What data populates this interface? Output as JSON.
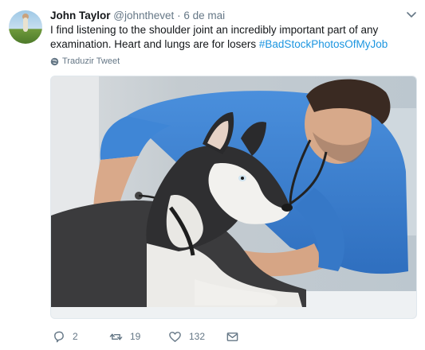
{
  "tweet": {
    "author_name": "John Taylor",
    "author_handle": "@johnthevet",
    "separator": "·",
    "date": "6 de mai",
    "text_main": "I find listening to the shoulder joint an incredibly important part of any examination. Heart and lungs are for losers",
    "hashtag": "#BadStockPhotosOfMyJob",
    "translate_label": "Traduzir Tweet"
  },
  "icons": {
    "avatar": "avatar",
    "menu": "chevron-down-icon",
    "translate": "globe-icon",
    "reply": "reply-icon",
    "retweet": "retweet-icon",
    "like": "heart-icon",
    "dm": "envelope-icon"
  },
  "actions": {
    "reply_count": "2",
    "retweet_count": "19",
    "like_count": "132"
  },
  "colors": {
    "link": "#1b95e0",
    "secondary": "#657786",
    "text": "#14171a",
    "scrubs": "#3a7fd0"
  }
}
